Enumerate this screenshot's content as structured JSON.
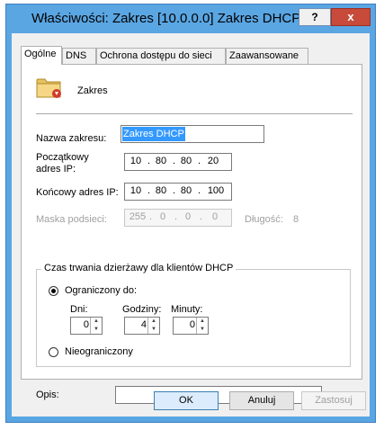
{
  "window": {
    "title": "Właściwości: Zakres [10.0.0.0] Zakres DHCP",
    "help_label": "?",
    "close_label": "x"
  },
  "tabs": [
    {
      "label": "Ogólne",
      "active": true
    },
    {
      "label": "DNS",
      "active": false
    },
    {
      "label": "Ochrona dostępu do sieci",
      "active": false
    },
    {
      "label": "Zaawansowane",
      "active": false
    }
  ],
  "general": {
    "scope_icon": "folder-icon",
    "scope_caption": "Zakres",
    "scope_name_label": "Nazwa zakresu:",
    "scope_name_value": "Zakres DHCP",
    "start_ip_label_line1": "Początkowy",
    "start_ip_label_line2": "adres IP:",
    "start_ip": [
      "10",
      "80",
      "80",
      "20"
    ],
    "end_ip_label": "Końcowy adres IP:",
    "end_ip": [
      "10",
      "80",
      "80",
      "100"
    ],
    "subnet_label": "Maska podsieci:",
    "subnet_mask": [
      "255",
      "0",
      "0",
      "0"
    ],
    "length_label": "Długość:",
    "length_value": "8",
    "lease_group_label": "Czas trwania dzierżawy dla klientów DHCP",
    "limited_label": "Ograniczony do:",
    "days_label": "Dni:",
    "days_value": "0",
    "hours_label": "Godziny:",
    "hours_value": "4",
    "minutes_label": "Minuty:",
    "minutes_value": "0",
    "unlimited_label": "Nieograniczony",
    "lease_selected": "limited",
    "description_label": "Opis:",
    "description_value": ""
  },
  "buttons": {
    "ok": "OK",
    "cancel": "Anuluj",
    "apply": "Zastosuj"
  }
}
